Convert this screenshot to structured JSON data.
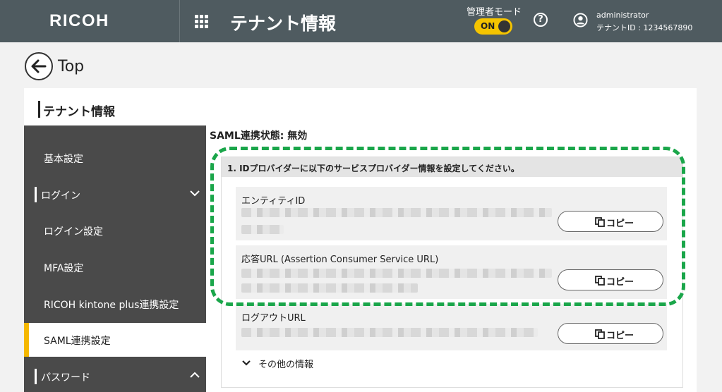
{
  "header": {
    "logo": "RICOH",
    "title": "テナント情報",
    "admin_mode_label": "管理者モード",
    "admin_mode_toggle": "ON",
    "user_name": "administrator",
    "tenant_id": "テナントID : 1234567890"
  },
  "nav": {
    "back_label": "Top"
  },
  "panel": {
    "title": "テナント情報"
  },
  "sidebar": {
    "items": [
      {
        "label": "基本設定"
      },
      {
        "label": "ログイン"
      },
      {
        "label": "ログイン設定"
      },
      {
        "label": "MFA設定"
      },
      {
        "label": "RICOH kintone plus連携設定"
      },
      {
        "label": "SAML連携設定"
      },
      {
        "label": "パスワード"
      }
    ]
  },
  "main": {
    "status": "SAML連携状態: 無効",
    "section_heading": "1. IDプロバイダーに以下のサービスプロバイダー情報を設定してください。",
    "fields": [
      {
        "label": "エンティティID",
        "copy_label": "コピー"
      },
      {
        "label": "応答URL (Assertion Consumer Service URL)",
        "copy_label": "コピー"
      },
      {
        "label": "ログアウトURL",
        "copy_label": "コピー"
      }
    ],
    "more_label": "その他の情報"
  },
  "colors": {
    "header_bg": "#4f5b60",
    "sidebar_bg": "#4a4a4a",
    "accent": "#f5b800",
    "toggle": "#f5c400",
    "highlight": "#1aa64a"
  }
}
